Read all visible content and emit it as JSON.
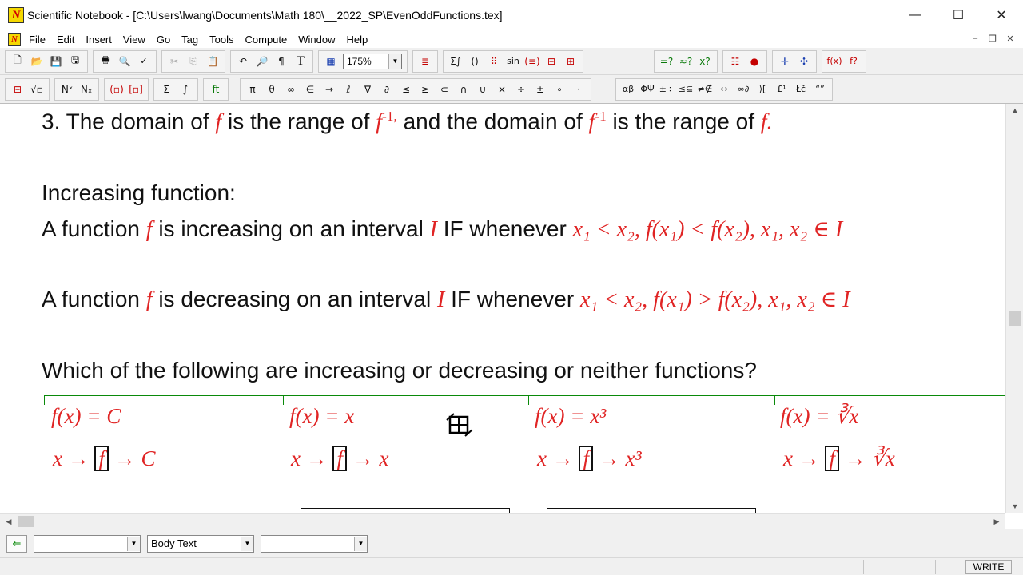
{
  "window": {
    "title": "Scientific Notebook - [C:\\Users\\lwang\\Documents\\Math 180\\__2022_SP\\EvenOddFunctions.tex]",
    "minimize": "—",
    "maximize": "☐",
    "close": "✕"
  },
  "menu": {
    "items": [
      "File",
      "Edit",
      "Insert",
      "View",
      "Go",
      "Tag",
      "Tools",
      "Compute",
      "Window",
      "Help"
    ],
    "mdi_minimize": "–",
    "mdi_restore": "❐",
    "mdi_close": "✕"
  },
  "toolbar1": {
    "zoom_value": "175%"
  },
  "toolbar2": {
    "symbols": [
      "π",
      "θ",
      "∞",
      "∈",
      "→",
      "ℓ",
      "∇",
      "∂",
      "≤",
      "≥",
      "⊂",
      "∩",
      "∪",
      "×",
      "÷",
      "±",
      "∘",
      "·"
    ]
  },
  "document": {
    "line1": {
      "p1": "3. The domain of ",
      "f": "f",
      "p2": " is the range of ",
      "finv": "f",
      "finv_sup": "-1,",
      "p3": " and the domain of ",
      "finv2": "f",
      "finv2_sup": "-1",
      "p4": " is the range of ",
      "f2": "f.",
      "period": ""
    },
    "inc_heading": "Increasing function:",
    "inc_line": {
      "p1": "A function ",
      "f": "f",
      "p2": " is increasing on an interval ",
      "I": "I",
      "p3": " IF whenever ",
      "cond": "x₁ < x₂, f(x₁) < f(x₂), x₁, x₂ ∈ I"
    },
    "dec_line": {
      "p1": "A function ",
      "f": "f",
      "p2": " is decreasing on an interval ",
      "I": "I",
      "p3": " IF whenever ",
      "cond": "x₁ < x₂, f(x₁) > f(x₂), x₁, x₂ ∈ I"
    },
    "question": "Which of the following are increasing or decreasing or neither functions?",
    "cells": [
      {
        "def": "f(x) = C",
        "map_in": "x →",
        "map_box": "f",
        "map_out": "→ C"
      },
      {
        "def": "f(x) = x",
        "map_in": "x →",
        "map_box": "f",
        "map_out": "→ x"
      },
      {
        "def": "f(x) = x³",
        "map_in": "x →",
        "map_box": "f",
        "map_out": "→ x³"
      },
      {
        "def": "f(x) = ∛x",
        "map_in": "x →",
        "map_box": "f",
        "map_out": "→ ∛x"
      }
    ]
  },
  "status": {
    "back_icon": "⇐",
    "style_combo": "",
    "body_text": "Body Text",
    "third_combo": "",
    "mode": "WRITE"
  }
}
